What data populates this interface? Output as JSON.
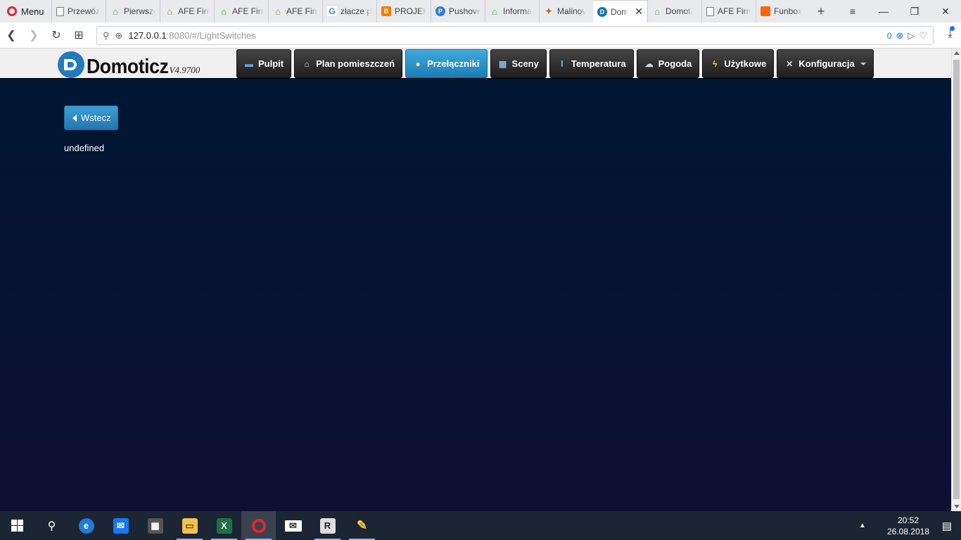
{
  "browser": {
    "menu_label": "Menu",
    "tabs": [
      {
        "label": "Przewóz",
        "icon": "document-icon"
      },
      {
        "label": "Pierwsze",
        "icon": "house-icon"
      },
      {
        "label": "AFE Firm",
        "icon": "house-icon"
      },
      {
        "label": "AFE Firm",
        "icon": "house-icon"
      },
      {
        "label": "AFE Firm",
        "icon": "house-icon"
      },
      {
        "label": "złacze p",
        "icon": "google-icon"
      },
      {
        "label": "PROJEKT",
        "icon": "blogger-icon"
      },
      {
        "label": "Pushove",
        "icon": "pushover-icon"
      },
      {
        "label": "Informa",
        "icon": "house-icon"
      },
      {
        "label": "Malinov",
        "icon": "raspberry-icon"
      },
      {
        "label": "Dom",
        "icon": "domoticz-icon",
        "active": true
      },
      {
        "label": "Domoti",
        "icon": "house-icon"
      },
      {
        "label": "AFE Firm",
        "icon": "document-icon"
      },
      {
        "label": "Funbox",
        "icon": "orange-icon"
      }
    ],
    "new_tab": "+",
    "address": {
      "host": "127.0.0.1",
      "rest": ":8080/#/LightSwitches",
      "adblock_count": "0"
    }
  },
  "app": {
    "logo_text": "Domoticz",
    "version": "V4.9700",
    "menu": [
      {
        "label": "Pulpit",
        "icon": "dashboard-icon"
      },
      {
        "label": "Plan pomieszczeń",
        "icon": "floorplan-icon"
      },
      {
        "label": "Przełączniki",
        "icon": "lightbulb-icon",
        "active": true
      },
      {
        "label": "Sceny",
        "icon": "scenes-icon"
      },
      {
        "label": "Temperatura",
        "icon": "thermometer-icon"
      },
      {
        "label": "Pogoda",
        "icon": "weather-icon"
      },
      {
        "label": "Użytkowe",
        "icon": "utility-icon"
      },
      {
        "label": "Konfiguracja",
        "icon": "tools-icon",
        "dropdown": true
      }
    ],
    "back_label": "Wstecz",
    "body_text": "undefined",
    "colors": {
      "header_bg": "#f0f0f0",
      "menu_bg": "#2a2a2a",
      "menu_active": "#2a8bc7",
      "content_bg_top": "#001633",
      "content_bg_bottom": "#0f0f33"
    }
  },
  "taskbar": {
    "time": "20:52",
    "date": "26.08.2018"
  }
}
